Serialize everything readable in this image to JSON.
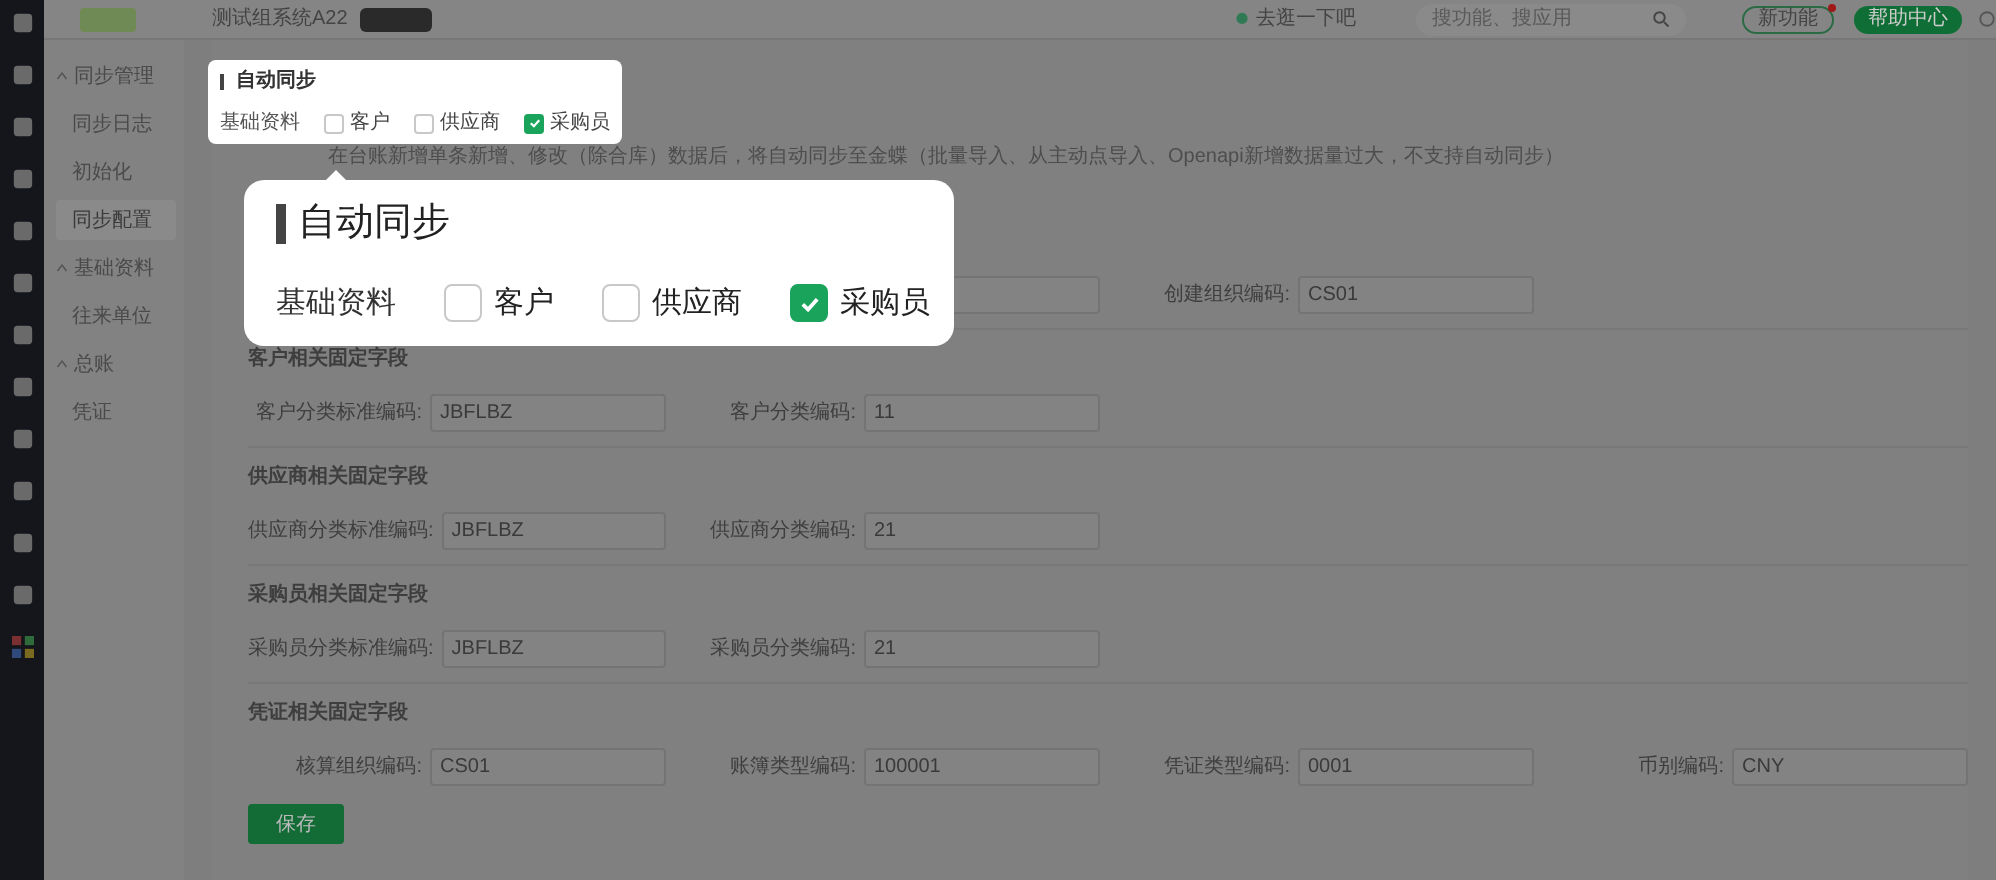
{
  "topbar": {
    "company": "测试组系统A22",
    "tip": "去逛一下吧",
    "search": {
      "placeholder": "搜功能、搜应用"
    },
    "buttons": [
      {
        "label": "新功能",
        "kind": "outline",
        "dot": true
      },
      {
        "label": "帮助中心",
        "kind": "solid",
        "dot": false
      }
    ]
  },
  "sidebar": {
    "groups": [
      {
        "label": "同步管理",
        "expanded": true,
        "children": [
          {
            "label": "同步日志",
            "selected": false
          },
          {
            "label": "初始化",
            "selected": false
          },
          {
            "label": "同步配置",
            "selected": true
          }
        ]
      },
      {
        "label": "基础资料",
        "expanded": true,
        "children": [
          {
            "label": "往来单位",
            "selected": false
          }
        ]
      },
      {
        "label": "总账",
        "expanded": true,
        "children": [
          {
            "label": "凭证",
            "selected": false
          }
        ]
      }
    ]
  },
  "description": "在台账新增单条新增、修改（除合库）数据后，将自动同步至金蝶（批量导入、从主动点导入、Openapi新增数据量过大，不支持自动同步）",
  "sections": [
    {
      "fields": [
        {
          "label": "创建组织编码:",
          "value": "CS01"
        }
      ]
    },
    {
      "title": "客户相关固定字段",
      "fields": [
        {
          "label": "客户分类标准编码:",
          "value": "JBFLBZ"
        },
        {
          "label": "客户分类编码:",
          "value": "11"
        }
      ]
    },
    {
      "title": "供应商相关固定字段",
      "fields": [
        {
          "label": "供应商分类标准编码:",
          "value": "JBFLBZ"
        },
        {
          "label": "供应商分类编码:",
          "value": "21"
        }
      ]
    },
    {
      "title": "采购员相关固定字段",
      "fields": [
        {
          "label": "采购员分类标准编码:",
          "value": "JBFLBZ"
        },
        {
          "label": "采购员分类编码:",
          "value": "21"
        }
      ]
    },
    {
      "title": "凭证相关固定字段",
      "fields": [
        {
          "label": "核算组织编码:",
          "value": "CS01"
        },
        {
          "label": "账簿类型编码:",
          "value": "100001"
        },
        {
          "label": "凭证类型编码:",
          "value": "0001"
        },
        {
          "label": "币别编码:",
          "value": "CNY"
        }
      ]
    }
  ],
  "save_button": "保存",
  "popup": {
    "title": "自动同步",
    "row_label": "基础资料",
    "options": [
      {
        "label": "客户",
        "checked": false
      },
      {
        "label": "供应商",
        "checked": false
      },
      {
        "label": "采购员",
        "checked": true
      }
    ]
  },
  "callout": {
    "title": "自动同步",
    "row_label": "基础资料",
    "options": [
      {
        "label": "客户",
        "checked": false
      },
      {
        "label": "供应商",
        "checked": false
      },
      {
        "label": "采购员",
        "checked": true
      }
    ]
  }
}
